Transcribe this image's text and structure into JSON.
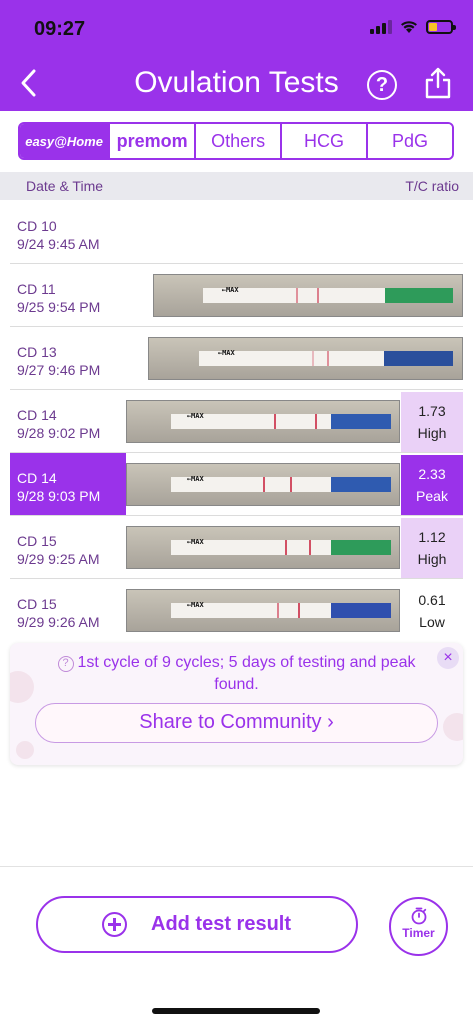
{
  "status_bar": {
    "time": "09:27"
  },
  "nav": {
    "title": "Ovulation Tests",
    "help_symbol": "?"
  },
  "tabs": [
    {
      "label": "easy@Home",
      "selected": true
    },
    {
      "label": "premom",
      "selected": false
    },
    {
      "label": "Others",
      "selected": false
    },
    {
      "label": "HCG",
      "selected": false
    },
    {
      "label": "PdG",
      "selected": false
    }
  ],
  "table": {
    "col_date": "Date & Time",
    "col_ratio": "T/C ratio",
    "rows": [
      {
        "cd": "CD 10",
        "datetime": "9/24 9:45 AM",
        "ratio": "",
        "level": "",
        "has_image": false
      },
      {
        "cd": "CD 11",
        "datetime": "9/25 9:54 PM",
        "ratio": "",
        "level": "",
        "has_image": true,
        "handle_color": "#2e9b5a"
      },
      {
        "cd": "CD 13",
        "datetime": "9/27 9:46 PM",
        "ratio": "",
        "level": "",
        "has_image": true,
        "handle_color": "#2a4f9c"
      },
      {
        "cd": "CD 14",
        "datetime": "9/28 9:02 PM",
        "ratio": "1.73",
        "level": "High",
        "has_image": true,
        "handle_color": "#2f5bb0"
      },
      {
        "cd": "CD 14",
        "datetime": "9/28 9:03 PM",
        "ratio": "2.33",
        "level": "Peak",
        "has_image": true,
        "selected": true,
        "handle_color": "#2f5bb0"
      },
      {
        "cd": "CD 15",
        "datetime": "9/29 9:25 AM",
        "ratio": "1.12",
        "level": "High",
        "has_image": true,
        "handle_color": "#2e9b5a"
      },
      {
        "cd": "CD 15",
        "datetime": "9/29 9:26 AM",
        "ratio": "0.61",
        "level": "Low",
        "has_image": true,
        "handle_color": "#2f4fae"
      }
    ],
    "strip_label": "←MAX"
  },
  "info_card": {
    "message": "1st cycle of 9 cycles; 5 days of testing and peak found.",
    "share_label": "Share to Community ›",
    "close_symbol": "×"
  },
  "actions": {
    "add_label": "Add test result",
    "timer_label": "Timer"
  },
  "colors": {
    "accent": "#9a32ea",
    "high": "#ead1f7",
    "text": "#6c3a8f"
  }
}
